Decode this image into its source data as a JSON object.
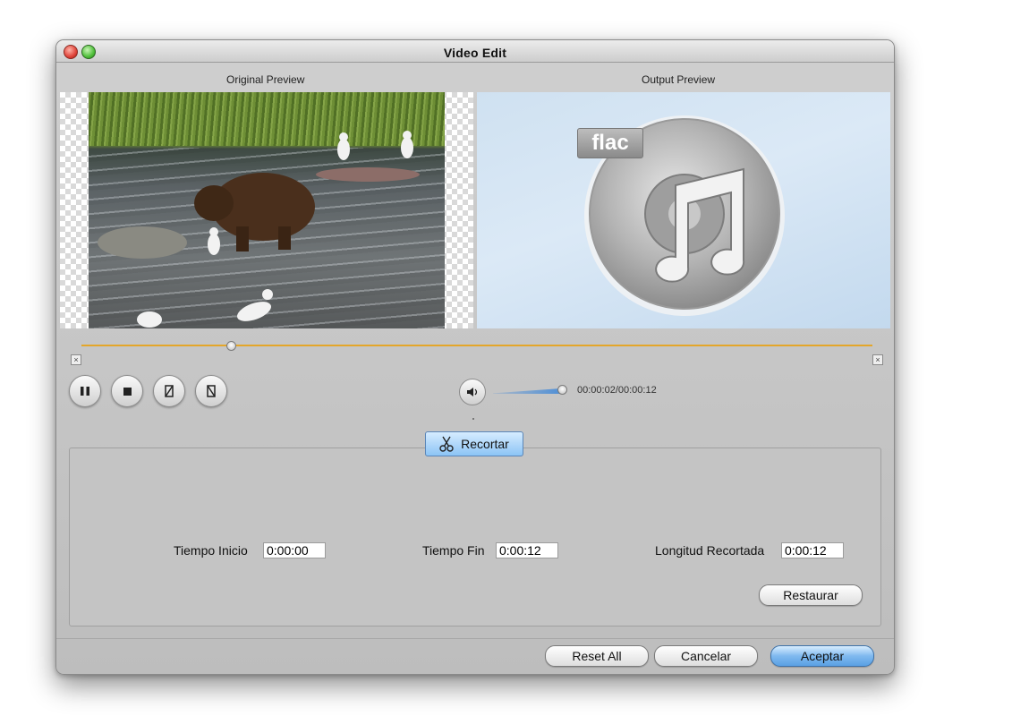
{
  "window": {
    "title": "Video Edit"
  },
  "previews": {
    "original_label": "Original Preview",
    "output_label": "Output Preview",
    "output_badge": "flac"
  },
  "playback": {
    "progress_fraction": 0.19,
    "volume_fraction": 1.0,
    "timecode": "00:00:02/00:00:12",
    "controls": [
      "pause-icon",
      "stop-icon",
      "mark-in-icon",
      "mark-out-icon"
    ]
  },
  "trim": {
    "tab_label": "Recortar",
    "start_label": "Tiempo Inicio",
    "start_value": "0:00:00",
    "end_label": "Tiempo Fin",
    "end_value": "0:00:12",
    "length_label": "Longitud Recortada",
    "length_value": "0:00:12",
    "restore_label": "Restaurar"
  },
  "footer": {
    "reset_all": "Reset All",
    "cancel": "Cancelar",
    "accept": "Aceptar"
  },
  "colors": {
    "scrubber": "#e4a62a",
    "accent": "#5aa0e4"
  }
}
